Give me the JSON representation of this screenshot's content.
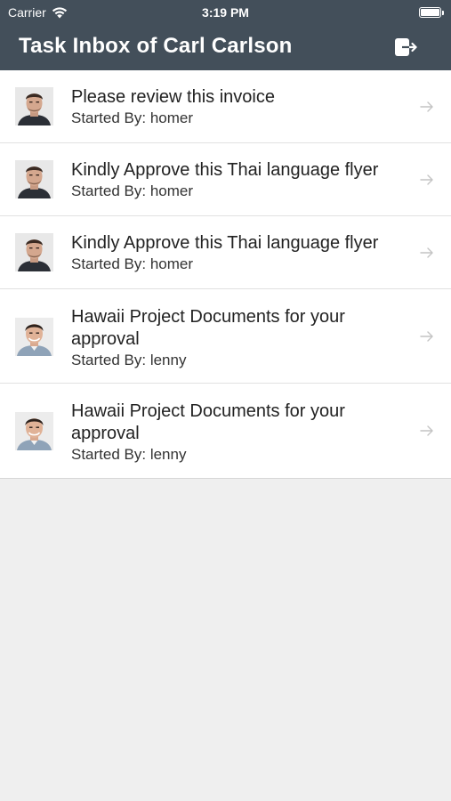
{
  "status_bar": {
    "carrier": "Carrier",
    "time": "3:19 PM"
  },
  "nav": {
    "title": "Task Inbox of Carl Carlson",
    "logout_icon": "logout-icon"
  },
  "tasks": [
    {
      "title": "Please review this invoice",
      "started_by": "Started By: homer",
      "avatar": "homer"
    },
    {
      "title": "Kindly Approve this Thai language flyer",
      "started_by": "Started By: homer",
      "avatar": "homer"
    },
    {
      "title": "Kindly Approve this Thai language flyer",
      "started_by": "Started By: homer",
      "avatar": "homer"
    },
    {
      "title": "Hawaii Project Documents for your approval",
      "started_by": "Started By: lenny",
      "avatar": "lenny"
    },
    {
      "title": "Hawaii Project Documents for your approval",
      "started_by": "Started By: lenny",
      "avatar": "lenny"
    }
  ],
  "colors": {
    "nav_background": "#434f5a",
    "list_background": "#ffffff",
    "page_background": "#efefef"
  }
}
